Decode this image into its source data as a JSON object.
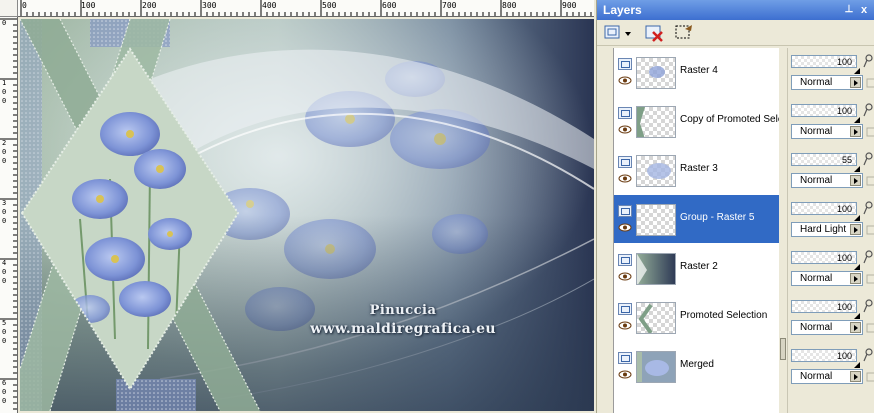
{
  "ruler": {
    "h_labels": [
      "0",
      "100",
      "200",
      "300",
      "400",
      "500",
      "600",
      "700",
      "800",
      "900"
    ],
    "v_labels": [
      "0",
      "100",
      "200",
      "300",
      "400",
      "500",
      "600"
    ]
  },
  "canvas": {
    "watermark_line1": "Pinuccia",
    "watermark_line2": "www.maldiregrafica.eu"
  },
  "layers_panel": {
    "title": "Layers",
    "pin_symbol": "⊥",
    "close_symbol": "x",
    "layers": [
      {
        "name": "Raster 4",
        "opacity": "100",
        "blend": "Normal",
        "selected": false
      },
      {
        "name": "Copy of Promoted Selection",
        "opacity": "100",
        "blend": "Normal",
        "selected": false
      },
      {
        "name": "Raster 3",
        "opacity": "55",
        "blend": "Normal",
        "selected": false
      },
      {
        "name": "Group - Raster 5",
        "opacity": "100",
        "blend": "Hard Light",
        "selected": true
      },
      {
        "name": "Raster 2",
        "opacity": "100",
        "blend": "Normal",
        "selected": false
      },
      {
        "name": "Promoted Selection",
        "opacity": "100",
        "blend": "Normal",
        "selected": false
      },
      {
        "name": "Merged",
        "opacity": "100",
        "blend": "Normal",
        "selected": false
      }
    ]
  },
  "colors": {
    "titlebar": "#3d6fd0",
    "selection": "#316ac5",
    "panel_bg": "#ece9d8"
  }
}
